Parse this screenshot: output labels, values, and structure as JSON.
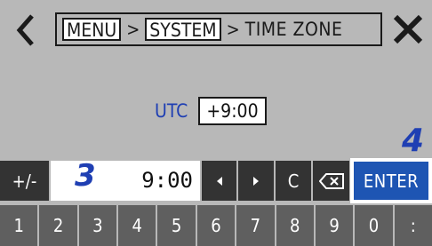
{
  "header": {
    "back_icon": "chevron-left-icon",
    "close_icon": "close-icon",
    "breadcrumb": [
      {
        "label": "MENU",
        "boxed": true
      },
      {
        "label": "SYSTEM",
        "boxed": true
      },
      {
        "label": "TIME ZONE",
        "boxed": false
      }
    ],
    "separator": ">"
  },
  "utc": {
    "label": "UTC",
    "value": "+9:00"
  },
  "callouts": {
    "step3": "3",
    "step4": "4"
  },
  "keypad": {
    "sign_label": "+/-",
    "input_value": "9:00",
    "left_icon": "triangle-left-icon",
    "right_icon": "triangle-right-icon",
    "clear_label": "C",
    "backspace_icon": "backspace-icon",
    "enter_label": "ENTER",
    "digits": [
      "1",
      "2",
      "3",
      "4",
      "5",
      "6",
      "7",
      "8",
      "9",
      "0",
      ":"
    ]
  },
  "colors": {
    "background": "#b8b8b8",
    "accent_blue": "#1f3fb3",
    "enter_blue": "#1e55b3",
    "key_dark": "#333333",
    "key_gray": "#5f5f5f"
  }
}
